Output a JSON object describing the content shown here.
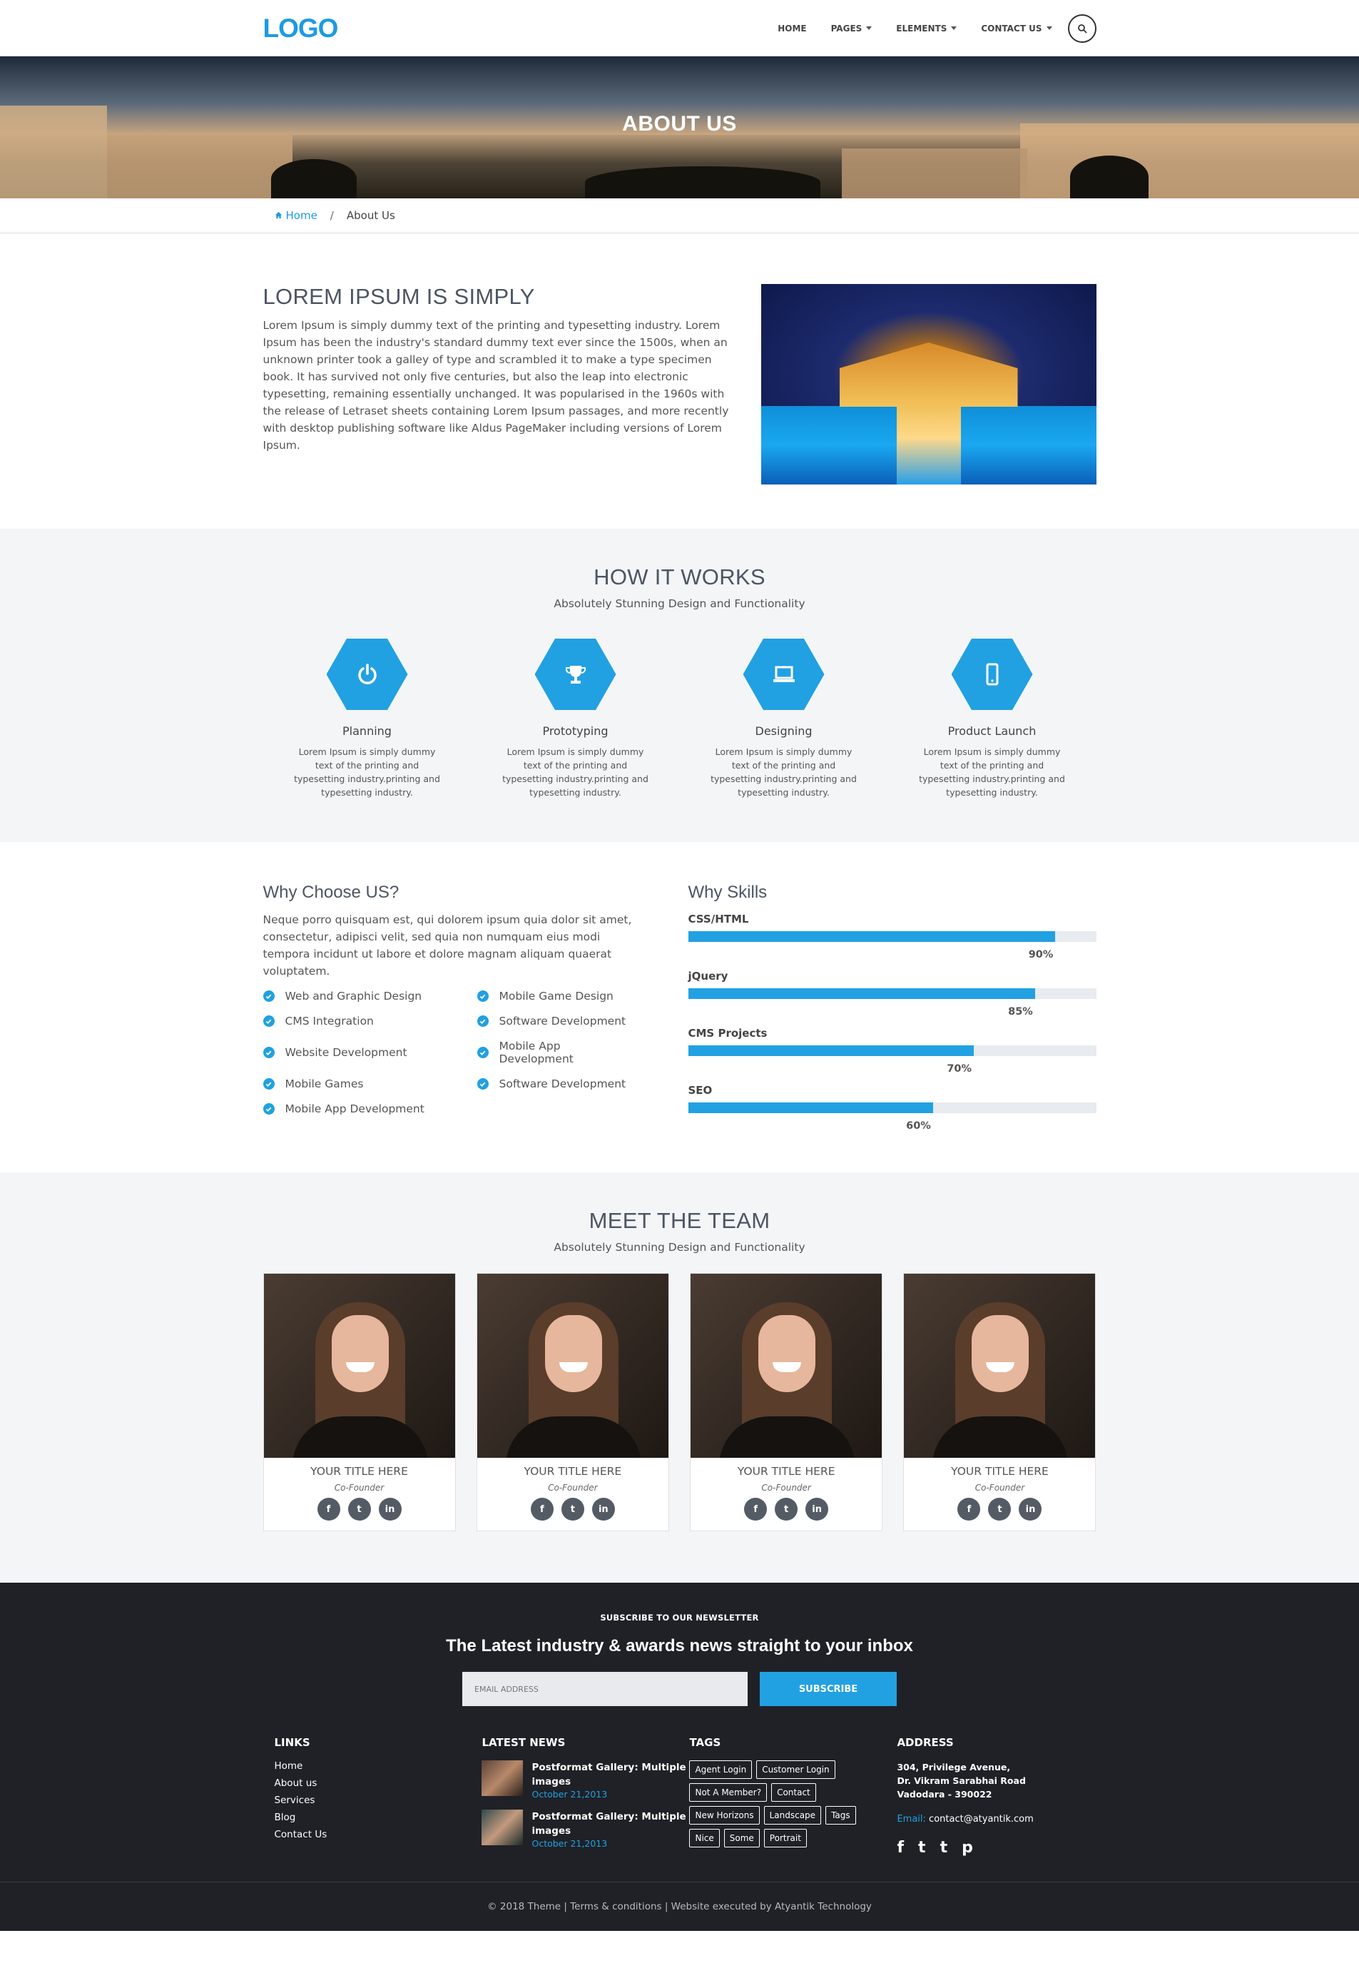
{
  "header": {
    "logo": "LOGO",
    "nav": [
      {
        "label": "HOME",
        "dropdown": false
      },
      {
        "label": "PAGES",
        "dropdown": true
      },
      {
        "label": "ELEMENTS",
        "dropdown": true
      },
      {
        "label": "CONTACT US",
        "dropdown": true
      }
    ]
  },
  "hero": {
    "title": "ABOUT US"
  },
  "breadcrumb": {
    "home": "Home",
    "sep": "/",
    "current": "About Us"
  },
  "intro": {
    "title": "LOREM IPSUM IS SIMPLY",
    "text": "Lorem Ipsum is simply dummy text of the printing and typesetting industry. Lorem Ipsum has been the industry's standard dummy text ever since the 1500s, when an unknown printer took a galley of type and scrambled it to make a type specimen book. It has survived not only five centuries, but also the leap into electronic typesetting, remaining essentially unchanged. It was popularised in the 1960s with the release of Letraset sheets containing Lorem Ipsum passages, and more recently with desktop publishing software like Aldus PageMaker including versions of Lorem Ipsum."
  },
  "how": {
    "title": "HOW IT WORKS",
    "subtitle": "Absolutely Stunning Design and Functionality",
    "steps": [
      {
        "title": "Planning",
        "icon": "power-icon",
        "text": "Lorem Ipsum is simply dummy text of the printing and typesetting industry.printing and typesetting industry."
      },
      {
        "title": "Prototyping",
        "icon": "trophy-icon",
        "text": "Lorem Ipsum is simply dummy text of the printing and typesetting industry.printing and typesetting industry."
      },
      {
        "title": "Designing",
        "icon": "laptop-icon",
        "text": "Lorem Ipsum is simply dummy text of the printing and typesetting industry.printing and typesetting industry."
      },
      {
        "title": "Product Launch",
        "icon": "mobile-icon",
        "text": "Lorem Ipsum is simply dummy text of the printing and typesetting industry.printing and typesetting industry."
      }
    ]
  },
  "why": {
    "title": "Why Choose US?",
    "text": "Neque porro quisquam est, qui dolorem ipsum quia dolor sit amet, consectetur, adipisci velit, sed quia non numquam eius modi tempora incidunt ut labore et dolore magnam aliquam quaerat voluptatem.",
    "checks": [
      "Web and Graphic Design",
      "Mobile Game Design",
      "CMS Integration",
      "Software Development",
      "Website Development",
      "Mobile App Development",
      "Mobile Games",
      "Software Development",
      "Mobile App Development"
    ]
  },
  "skills": {
    "title": "Why Skills",
    "items": [
      {
        "name": "CSS/HTML",
        "percent": 90,
        "label": "90%"
      },
      {
        "name": "jQuery",
        "percent": 85,
        "label": "85%"
      },
      {
        "name": "CMS Projects",
        "percent": 70,
        "label": "70%"
      },
      {
        "name": "SEO",
        "percent": 60,
        "label": "60%"
      }
    ]
  },
  "team": {
    "title": "MEET THE TEAM",
    "subtitle": "Absolutely Stunning Design and Functionality",
    "members": [
      {
        "name": "YOUR TITLE HERE",
        "role": "Co-Founder"
      },
      {
        "name": "YOUR TITLE HERE",
        "role": "Co-Founder"
      },
      {
        "name": "YOUR TITLE HERE",
        "role": "Co-Founder"
      },
      {
        "name": "YOUR TITLE HERE",
        "role": "Co-Founder"
      }
    ],
    "social": [
      "f",
      "t",
      "in"
    ]
  },
  "newsletter": {
    "label": "SUBSCRIBE TO OUR NEWSLETTER",
    "title": "The Latest industry & awards news straight to your inbox",
    "placeholder": "EMAIL ADDRESS",
    "button": "SUBSCRIBE"
  },
  "footer": {
    "links_title": "LINKS",
    "links": [
      "Home",
      "About us",
      "Services",
      "Blog",
      "Contact Us"
    ],
    "news_title": "LATEST NEWS",
    "news": [
      {
        "title": "Postformat Gallery: Multiple images",
        "date": "October 21,2013"
      },
      {
        "title": "Postformat Gallery: Multiple images",
        "date": "October 21,2013"
      }
    ],
    "tags_title": "TAGS",
    "tags": [
      "Agent Login",
      "Customer Login",
      "Not A Member?",
      "Contact",
      "New Horizons",
      "Landscape",
      "Tags",
      "Nice",
      "Some",
      "Portrait"
    ],
    "address_title": "ADDRESS",
    "address": [
      "304, Privilege Avenue,",
      "Dr. Vikram Sarabhai Road",
      "Vadodara - 390022"
    ],
    "email_label": "Email:",
    "email": "contact@atyantik.com",
    "social": [
      "f",
      "t",
      "t",
      "p"
    ],
    "copyright": "© 2018 Theme | Terms & conditions | Website executed by Atyantik Technology"
  },
  "colors": {
    "accent": "#21a1e1",
    "footer_bg": "#1f2127",
    "section_bg": "#f4f5f7"
  }
}
